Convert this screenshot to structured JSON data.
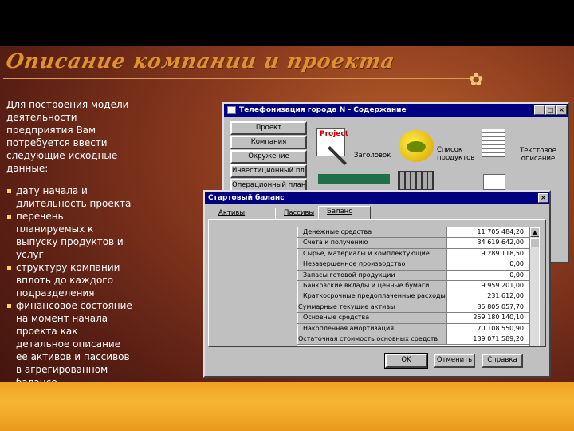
{
  "slide": {
    "title": "Описание компании и проекта",
    "intro": "Для построения модели деятельности предприятия Вам потребуется ввести следующие исходные данные:",
    "bullets": [
      "дату начала и длительность проекта",
      "перечень планируемых к выпуску продуктов и услуг",
      "структуру компании вплоть до каждого подразделения",
      "финансовое состояние на момент начала проекта как детальное описание ее активов и пассивов в агрегированном балансе"
    ]
  },
  "content_window": {
    "title": "Телефонизация города N - Содержание",
    "controls": [
      "_",
      "□",
      "×"
    ],
    "nav": [
      "Проект",
      "Компания",
      "Окружение",
      "Инвестиционный план",
      "Операционный план"
    ],
    "icons": [
      {
        "label": "Заголовок",
        "icon": "project-title-icon"
      },
      {
        "label": "Список продуктов",
        "icon": "product-basket-icon"
      },
      {
        "label": "Текстовое описание",
        "icon": "text-document-icon"
      }
    ]
  },
  "balance_dialog": {
    "title": "Стартовый баланс",
    "close": "×",
    "tabs": [
      "Активы",
      "Пассивы",
      "Баланс"
    ],
    "active_tab": "Баланс",
    "rows": [
      {
        "label": "Денежные средства",
        "value": "11 705 484,20"
      },
      {
        "label": "Счета к получению",
        "value": "34 619 642,00"
      },
      {
        "label": "Сырье, материалы и комплектующие",
        "value": "9 289 118,50"
      },
      {
        "label": "Незавершенное производство",
        "value": "0,00"
      },
      {
        "label": "Запасы готовой продукции",
        "value": "0,00"
      },
      {
        "label": "Банковские вклады и ценные бумаги",
        "value": "9 959 201,00"
      },
      {
        "label": "Краткосрочные предоплаченные расходы",
        "value": "231 612,00"
      },
      {
        "label": "Суммарные текущие активы",
        "value": "35 805 057,70"
      },
      {
        "label": "Основные средства",
        "value": "259 180 140,10"
      },
      {
        "label": "Накопленная амортизация",
        "value": "70 108 550,90"
      },
      {
        "label": "Остаточная стоимость основных средств",
        "value": "139 071 589,20"
      }
    ],
    "buttons": {
      "ok": "OK",
      "cancel": "Отменить",
      "help": "Справка"
    }
  }
}
